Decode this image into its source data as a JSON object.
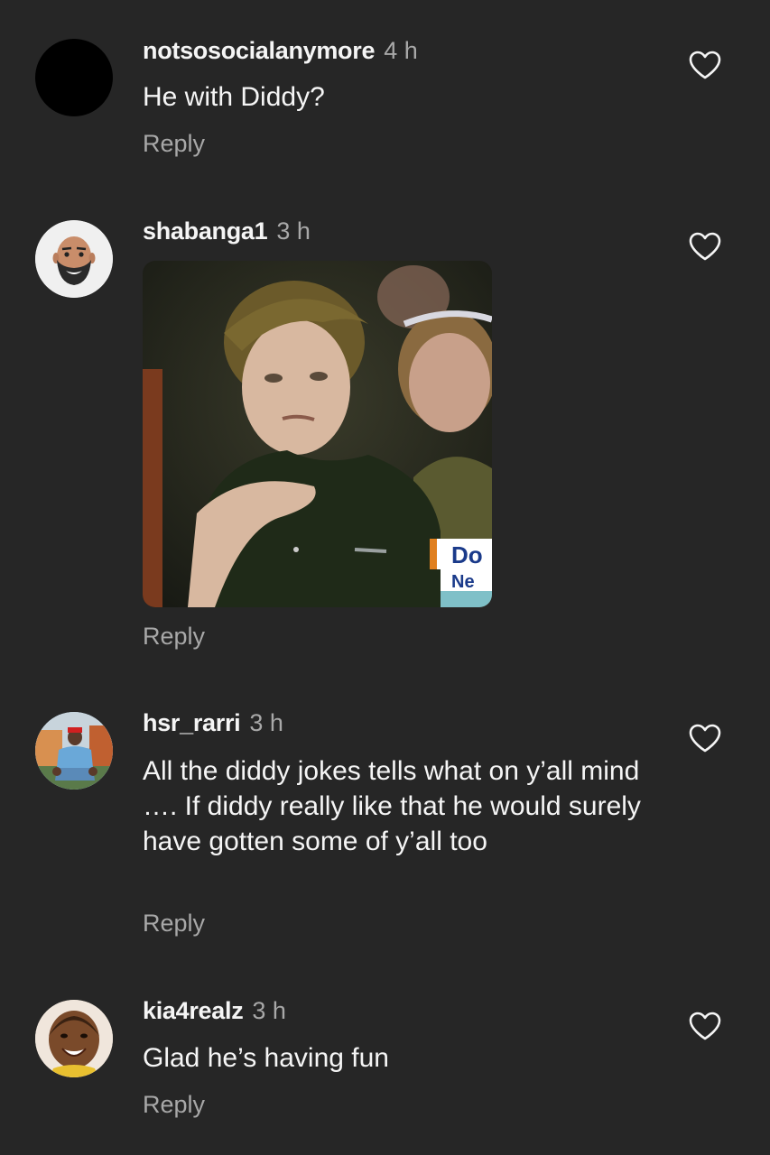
{
  "comments": [
    {
      "username": "notsosocialanymore",
      "time": "4 h",
      "text": "He with Diddy?",
      "reply_label": "Reply",
      "avatar": "black-circle-avatar"
    },
    {
      "username": "shabanga1",
      "time": "3 h",
      "text": "",
      "reply_label": "Reply",
      "avatar": "bald-bearded-memoji-avatar",
      "media": {
        "type": "gif-image",
        "overlay_text_1": "Do",
        "overlay_text_2": "Ne"
      }
    },
    {
      "username": "hsr_rarri",
      "time": "3 h",
      "text": "All the diddy jokes tells what on y’all mind …. If diddy really like that he would surely have gotten some of y’all too",
      "reply_label": "Reply",
      "avatar": "person-in-red-cap-avatar"
    },
    {
      "username": "kia4realz",
      "time": "3 h",
      "text": "Glad he’s having fun",
      "reply_label": "Reply",
      "avatar": "smiling-baby-avatar"
    }
  ],
  "colors": {
    "background": "#262626",
    "primary_text": "#f5f5f5",
    "secondary_text": "#a8a8a8"
  },
  "icons": {
    "like": "heart-outline-icon"
  }
}
